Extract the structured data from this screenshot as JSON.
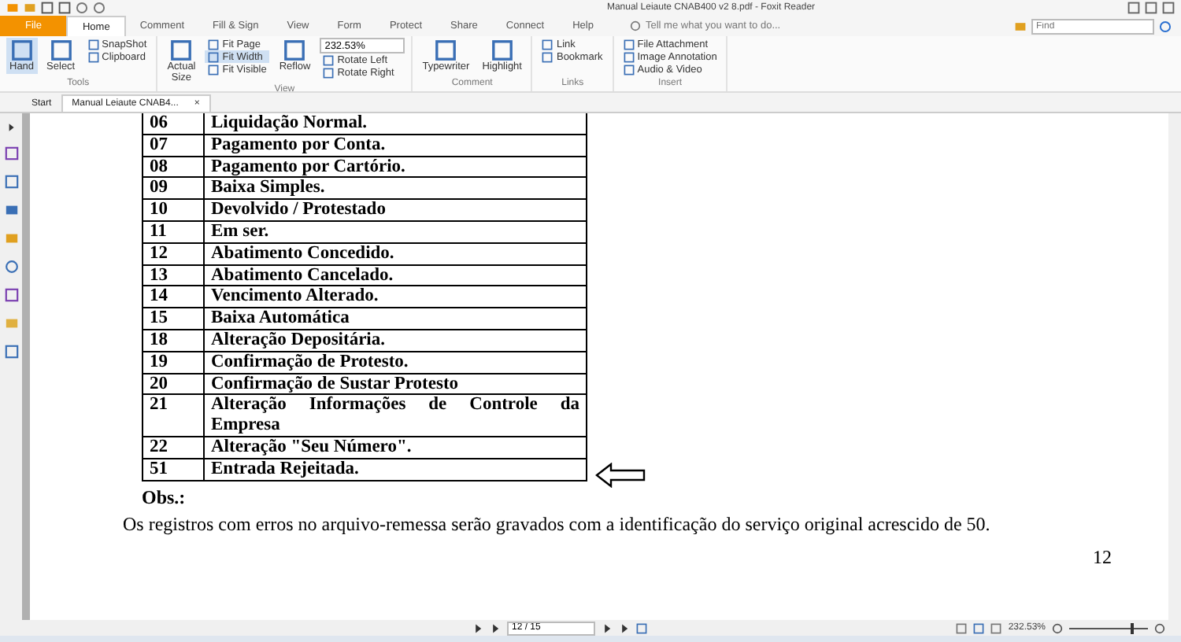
{
  "window": {
    "title": "Manual Leiaute CNAB400 v2 8.pdf - Foxit Reader"
  },
  "menu_tabs": [
    {
      "label": "File",
      "kind": "file",
      "selected": false
    },
    {
      "label": "Home",
      "kind": "tab",
      "selected": true
    },
    {
      "label": "Comment",
      "kind": "tab",
      "selected": false
    },
    {
      "label": "Fill & Sign",
      "kind": "tab",
      "selected": false
    },
    {
      "label": "View",
      "kind": "tab",
      "selected": false
    },
    {
      "label": "Form",
      "kind": "tab",
      "selected": false
    },
    {
      "label": "Protect",
      "kind": "tab",
      "selected": false
    },
    {
      "label": "Share",
      "kind": "tab",
      "selected": false
    },
    {
      "label": "Connect",
      "kind": "tab",
      "selected": false
    },
    {
      "label": "Help",
      "kind": "tab",
      "selected": false
    }
  ],
  "tell_me": {
    "placeholder": "Tell me what you want to do..."
  },
  "find": {
    "placeholder": "Find"
  },
  "ribbon_groups": [
    {
      "label": "Tools",
      "columns": [
        [
          {
            "label": "Hand",
            "kind": "large",
            "selected": true
          }
        ],
        [
          {
            "label": "Select",
            "kind": "large",
            "selected": false
          }
        ],
        [
          {
            "label": "SnapShot",
            "kind": "small",
            "selected": false
          },
          {
            "label": "Clipboard",
            "kind": "small",
            "selected": false
          }
        ]
      ]
    },
    {
      "label": "View",
      "columns": [
        [
          {
            "label": "Actual Size",
            "kind": "large",
            "selected": false
          }
        ],
        [
          {
            "label": "Fit Page",
            "kind": "small",
            "selected": false
          },
          {
            "label": "Fit Width",
            "kind": "small",
            "selected": true
          },
          {
            "label": "Fit Visible",
            "kind": "small",
            "selected": false
          }
        ],
        [
          {
            "label": "Reflow",
            "kind": "large",
            "selected": false
          }
        ],
        [
          {
            "label": "232.53%",
            "kind": "zoom",
            "selected": false
          },
          {
            "label": "Rotate Left",
            "kind": "small",
            "selected": false
          },
          {
            "label": "Rotate Right",
            "kind": "small",
            "selected": false
          }
        ]
      ]
    },
    {
      "label": "Comment",
      "columns": [
        [
          {
            "label": "Typewriter",
            "kind": "large",
            "selected": false
          }
        ],
        [
          {
            "label": "Highlight",
            "kind": "large",
            "selected": false
          }
        ]
      ]
    },
    {
      "label": "Links",
      "columns": [
        [
          {
            "label": "Link",
            "kind": "small",
            "selected": false
          },
          {
            "label": "Bookmark",
            "kind": "small",
            "selected": false
          }
        ]
      ]
    },
    {
      "label": "Insert",
      "columns": [
        [
          {
            "label": "File Attachment",
            "kind": "small",
            "selected": false
          },
          {
            "label": "Image Annotation",
            "kind": "small",
            "selected": false
          },
          {
            "label": "Audio & Video",
            "kind": "small",
            "selected": false
          }
        ]
      ]
    }
  ],
  "doc_tabs": [
    {
      "label": "Start",
      "selected": false,
      "closable": false
    },
    {
      "label": "Manual Leiaute CNAB4...",
      "selected": true,
      "closable": true
    }
  ],
  "close_glyph": "×",
  "table": {
    "rows": [
      {
        "code": "06",
        "description": "Liquidação Normal."
      },
      {
        "code": "07",
        "description": "Pagamento por Conta."
      },
      {
        "code": "08",
        "description": "Pagamento por Cartório."
      },
      {
        "code": "09",
        "description": "Baixa Simples."
      },
      {
        "code": "10",
        "description": "Devolvido / Protestado"
      },
      {
        "code": "11",
        "description": "Em ser."
      },
      {
        "code": "12",
        "description": "Abatimento Concedido."
      },
      {
        "code": "13",
        "description": "Abatimento Cancelado."
      },
      {
        "code": "14",
        "description": "Vencimento Alterado."
      },
      {
        "code": "15",
        "description": "Baixa Automática"
      },
      {
        "code": "18",
        "description": "Alteração Depositária."
      },
      {
        "code": "19",
        "description": "Confirmação de Protesto."
      },
      {
        "code": "20",
        "description": "Confirmação de Sustar Protesto"
      },
      {
        "code": "21",
        "description": "Alteração Informações de Controle da Empresa"
      },
      {
        "code": "22",
        "description": "Alteração \"Seu Número\"."
      },
      {
        "code": "51",
        "description": "Entrada Rejeitada."
      }
    ]
  },
  "obs_label": "Obs.:",
  "obs_text": "Os registros com erros no arquivo-remessa serão gravados com a identificação do serviço original acrescido de 50.",
  "page_number": "12",
  "status_bar": {
    "page": "12 / 15",
    "zoom": "232.53%",
    "zoom_slider": {
      "level": 0.78
    }
  }
}
